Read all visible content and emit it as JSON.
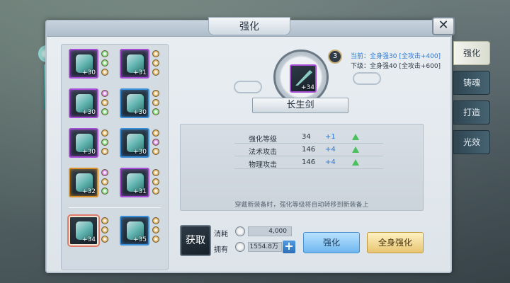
{
  "window": {
    "title": "强化",
    "close_symbol": "✕"
  },
  "equipment": [
    {
      "level": "+30",
      "rarity": "purple",
      "gems": [
        "#6bd36b",
        "#6bd36b",
        "#d8a84a"
      ]
    },
    {
      "level": "+31",
      "rarity": "purple",
      "gems": [
        "#d8a84a",
        "#d8a84a",
        "#d8a84a"
      ]
    },
    {
      "level": "+30",
      "rarity": "purple",
      "gems": [
        "#c86ad6",
        "#d8a84a",
        "#6bd36b"
      ]
    },
    {
      "level": "+30",
      "rarity": "blue",
      "gems": [
        "#d8a84a",
        "#d8a84a",
        "#6bd36b"
      ]
    },
    {
      "level": "+30",
      "rarity": "purple",
      "gems": [
        "#d8a84a",
        "#6bd36b",
        "#d8a84a"
      ]
    },
    {
      "level": "+30",
      "rarity": "blue",
      "gems": [
        "#d8a84a",
        "#c86ad6",
        "#d8a84a"
      ]
    },
    {
      "level": "+32",
      "rarity": "orange",
      "gems": [
        "#c86ad6",
        "#d8a84a",
        "#6bd36b"
      ]
    },
    {
      "level": "+31",
      "rarity": "purple",
      "gems": [
        "#d8a84a",
        "#d8a84a",
        "#d8a84a"
      ]
    },
    {
      "level": "+34",
      "rarity": "selected",
      "gems": [
        "#d8a84a",
        "#d8a84a",
        "#d8a84a"
      ]
    },
    {
      "level": "+35",
      "rarity": "blue",
      "gems": [
        "#d8a84a",
        "#d8a84a",
        "#d8a84a"
      ]
    }
  ],
  "weapon": {
    "name": "长生剑",
    "level": "+34",
    "rank": "3",
    "current_label": "当前：全身强30 [全攻击+400]",
    "next_label": "下级：全身强40 [全攻击+600]"
  },
  "attributes": [
    {
      "name": "强化等级",
      "value": "34",
      "plus": "+1"
    },
    {
      "name": "法术攻击",
      "value": "146",
      "plus": "+4"
    },
    {
      "name": "物理攻击",
      "value": "146",
      "plus": "+4"
    }
  ],
  "hint": "穿戴新装备时，强化等级将自动转移到新装备上",
  "resources": {
    "fetch_label": "获取",
    "fetch_tag": "",
    "cost_label": "消耗",
    "cost_value": "4,000",
    "own_label": "拥有",
    "own_value": "1554.8万"
  },
  "buttons": {
    "enhance": "强化",
    "enhance_all": "全身强化"
  },
  "side_tabs": [
    {
      "label": "强化",
      "active": true
    },
    {
      "label": "铸魂",
      "active": false
    },
    {
      "label": "打造",
      "active": false
    },
    {
      "label": "光效",
      "active": false
    }
  ]
}
